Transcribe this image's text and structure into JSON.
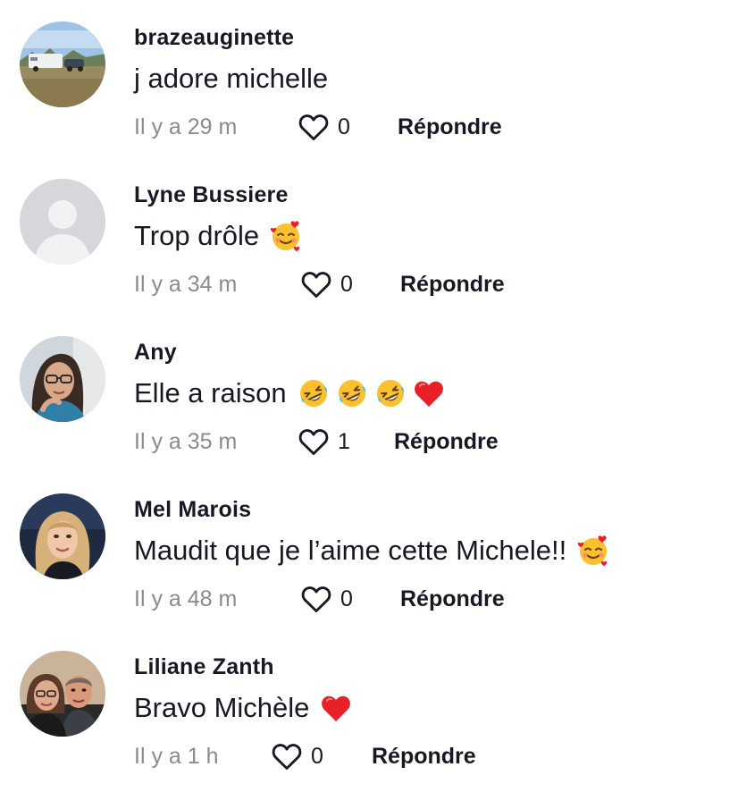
{
  "comments": [
    {
      "username": "brazeauginette",
      "text": "j adore michelle",
      "time": "Il y a 29 m",
      "likes": "0",
      "reply_label": "Répondre",
      "avatar": "rv-landscape-photo",
      "emojis": []
    },
    {
      "username": "Lyne Bussiere",
      "text": "Trop drôle",
      "time": "Il y a 34 m",
      "likes": "0",
      "reply_label": "Répondre",
      "avatar": "default-avatar",
      "emojis": [
        "smiling-face-with-hearts"
      ]
    },
    {
      "username": "Any",
      "text": "Elle a raison",
      "time": "Il y a 35 m",
      "likes": "1",
      "reply_label": "Répondre",
      "avatar": "woman-with-glasses-photo",
      "emojis": [
        "rolling-laughing-face",
        "rolling-laughing-face",
        "rolling-laughing-face",
        "red-heart"
      ]
    },
    {
      "username": "Mel Marois",
      "text": "Maudit que je l’aime cette Michele!!",
      "time": "Il y a 48 m",
      "likes": "0",
      "reply_label": "Répondre",
      "avatar": "blonde-woman-photo",
      "emojis": [
        "smiling-face-with-hearts"
      ]
    },
    {
      "username": "Liliane Zanth",
      "text": "Bravo Michèle",
      "time": "Il y a 1 h",
      "likes": "0",
      "reply_label": "Répondre",
      "avatar": "couple-photo",
      "emojis": [
        "red-heart"
      ]
    }
  ],
  "colors": {
    "text": "#161823",
    "muted": "#8a8b91",
    "heart_red": "#e8202a",
    "emoji_yellow": "#fbc02d"
  }
}
